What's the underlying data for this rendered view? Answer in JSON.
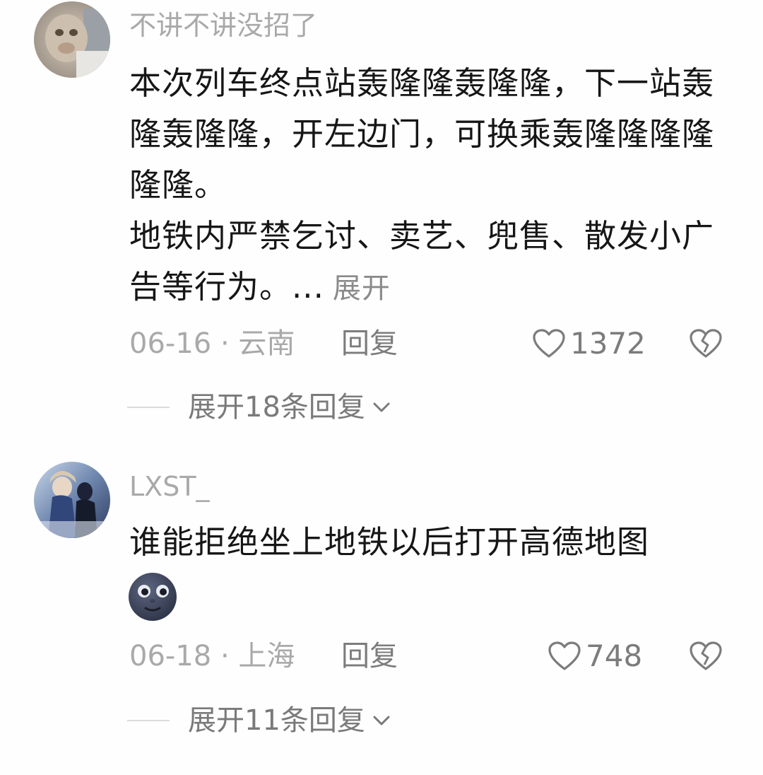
{
  "comments": [
    {
      "username": "不讲不讲没招了",
      "body_lines": [
        "本次列车终点站轰隆隆轰隆隆，下一站轰隆轰隆隆，开左边门，可换乘轰隆隆隆隆隆隆。",
        "地铁内严禁乞讨、卖艺、兜售、散发小广告等行为。..."
      ],
      "expand_label": "展开",
      "date_location": "06-16 · 云南",
      "reply_label": "回复",
      "likes": "1372",
      "replies_label": "展开18条回复"
    },
    {
      "username": "LXST_",
      "body_lines": [
        "谁能拒绝坐上地铁以后打开高德地图"
      ],
      "date_location": "06-18 · 上海",
      "reply_label": "回复",
      "likes": "748",
      "replies_label": "展开11条回复"
    }
  ],
  "icons": {
    "like": "heart-outline-icon",
    "dislike": "broken-heart-icon",
    "expand": "chevron-down-icon",
    "emoji": "new-moon-face-emoji"
  }
}
